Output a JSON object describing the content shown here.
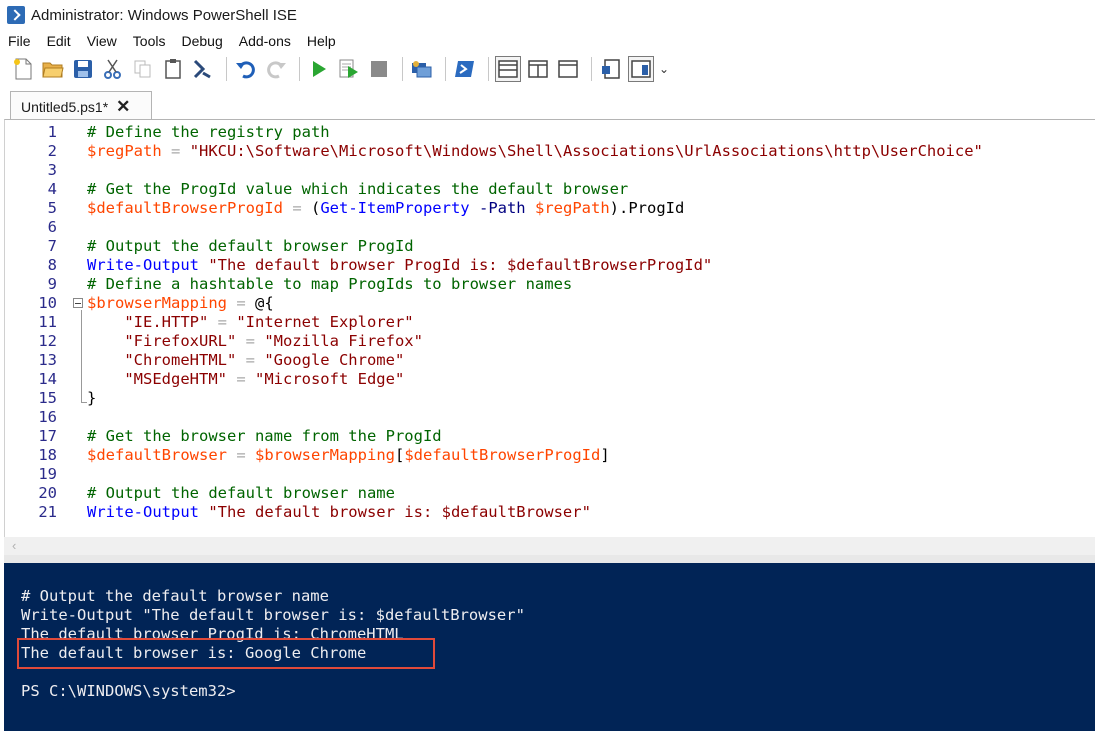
{
  "window": {
    "title": "Administrator: Windows PowerShell ISE"
  },
  "menu": [
    "File",
    "Edit",
    "View",
    "Tools",
    "Debug",
    "Add-ons",
    "Help"
  ],
  "toolbar": {
    "icons": [
      "new-file-icon",
      "open-folder-icon",
      "save-icon",
      "cut-icon",
      "copy-icon",
      "paste-icon",
      "clear-console-icon",
      "undo-icon",
      "redo-icon",
      "run-script-icon",
      "run-selection-icon",
      "stop-icon",
      "new-remote-tab-icon",
      "start-powershell-icon",
      "show-script-pane-top-icon",
      "show-script-pane-right-icon",
      "show-script-pane-maximized-icon",
      "show-command-window-icon",
      "show-command-addon-icon"
    ],
    "overflow_label": "⌄"
  },
  "tab": {
    "label": "Untitled5.ps1*",
    "close_glyph": "✕"
  },
  "editor": {
    "lines": [
      {
        "n": "1",
        "text": "# Define the registry path"
      },
      {
        "n": "2",
        "text": "$regPath = \"HKCU:\\Software\\Microsoft\\Windows\\Shell\\Associations\\UrlAssociations\\http\\UserChoice\""
      },
      {
        "n": "3",
        "text": ""
      },
      {
        "n": "4",
        "text": "# Get the ProgId value which indicates the default browser"
      },
      {
        "n": "5",
        "text": "$defaultBrowserProgId = (Get-ItemProperty -Path $regPath).ProgId"
      },
      {
        "n": "6",
        "text": ""
      },
      {
        "n": "7",
        "text": "# Output the default browser ProgId"
      },
      {
        "n": "8",
        "text": "Write-Output \"The default browser ProgId is: $defaultBrowserProgId\""
      },
      {
        "n": "9",
        "text": "# Define a hashtable to map ProgIds to browser names"
      },
      {
        "n": "10",
        "text": "$browserMapping = @{"
      },
      {
        "n": "11",
        "text": "    \"IE.HTTP\" = \"Internet Explorer\""
      },
      {
        "n": "12",
        "text": "    \"FirefoxURL\" = \"Mozilla Firefox\""
      },
      {
        "n": "13",
        "text": "    \"ChromeHTML\" = \"Google Chrome\""
      },
      {
        "n": "14",
        "text": "    \"MSEdgeHTM\" = \"Microsoft Edge\""
      },
      {
        "n": "15",
        "text": "}"
      },
      {
        "n": "16",
        "text": ""
      },
      {
        "n": "17",
        "text": "# Get the browser name from the ProgId"
      },
      {
        "n": "18",
        "text": "$defaultBrowser = $browserMapping[$defaultBrowserProgId]"
      },
      {
        "n": "19",
        "text": ""
      },
      {
        "n": "20",
        "text": "# Output the default browser name"
      },
      {
        "n": "21",
        "text": "Write-Output \"The default browser is: $defaultBrowser\""
      }
    ]
  },
  "console": {
    "lines": [
      "# Output the default browser name",
      "Write-Output \"The default browser is: $defaultBrowser\"",
      "The default browser ProgId is: ChromeHTML",
      "The default browser is: Google Chrome",
      "",
      "PS C:\\WINDOWS\\system32>"
    ],
    "highlight_color": "#e04a3a",
    "background": "#012456"
  },
  "colors": {
    "comment": "#006400",
    "variable": "#ff4500",
    "string": "#8b0000",
    "command": "#0000ff",
    "line_number": "#2a2a8a"
  }
}
